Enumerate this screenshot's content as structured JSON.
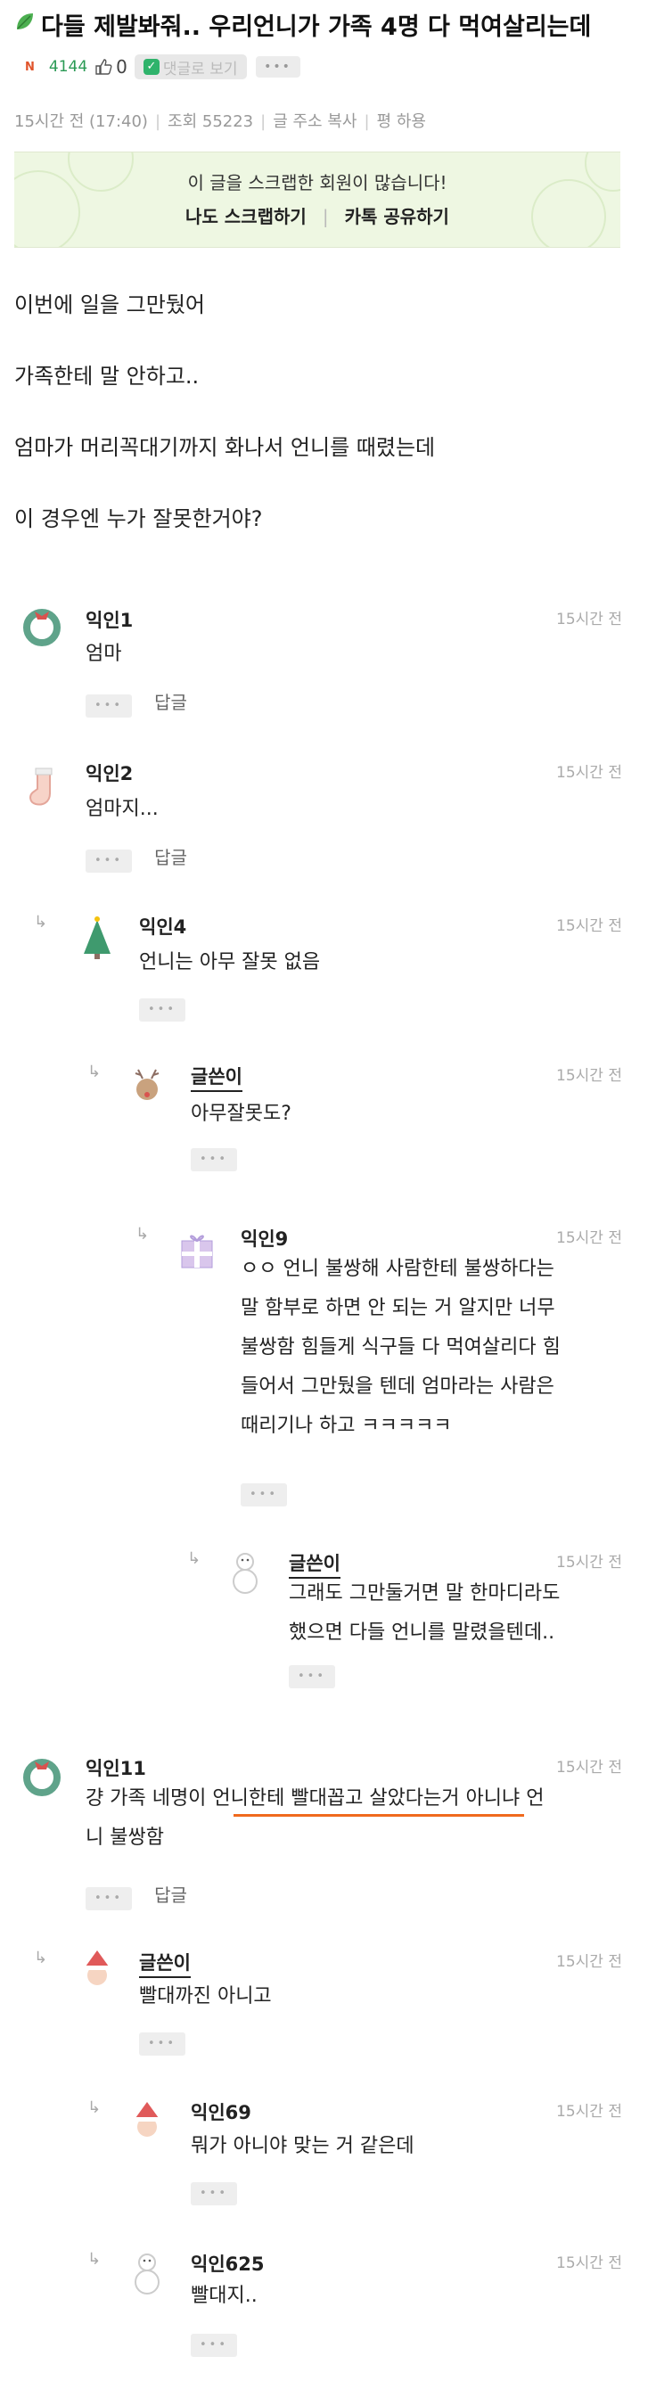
{
  "header": {
    "title": "다들 제발봐줘.. 우리언니가 가족 4명 다 먹여살리는데",
    "badge": "N",
    "count": "4144",
    "likes": "0",
    "pill_label": "댓글로 보기",
    "more": "•••",
    "time": "15시간 전 (17:40)",
    "views": "조회 55223",
    "copy": "글 주소 복사",
    "report": "평 하용"
  },
  "scrap": {
    "message": "이 글을 스크랩한 회원이 많습니다!",
    "action1": "나도 스크랩하기",
    "action2": "카톡 공유하기"
  },
  "body": {
    "p1": "이번에 일을 그만뒀어",
    "p2": "가족한테 말 안하고..",
    "p3": "엄마가 머리꼭대기까지 화나서 언니를 때렸는데",
    "p4": "이 경우엔 누가 잘못한거야?"
  },
  "comments": [
    {
      "name": "익인1",
      "time": "15시간 전",
      "text": "엄마",
      "more": "•••",
      "reply": "답글"
    },
    {
      "name": "익인2",
      "time": "15시간 전",
      "text": "엄마지...",
      "more": "•••",
      "reply": "답글"
    },
    {
      "name": "익인4",
      "time": "15시간 전",
      "text": "언니는 아무 잘못 없음",
      "more": "•••"
    },
    {
      "name": "글쓴이",
      "time": "15시간 전",
      "text": "아무잘못도?",
      "more": "•••"
    },
    {
      "name": "익인9",
      "time": "15시간 전",
      "line1": "ㅇㅇ 언니 불쌍해 사람한테 불쌍하다는",
      "line2": "말 함부로 하면 안 되는 거 알지만 너무",
      "line3": "불쌍함 힘들게 식구들 다 먹여살리다 힘",
      "line4": "들어서 그만뒀을 텐데 엄마라는 사람은",
      "line5": "때리기나 하고 ㅋㅋㅋㅋㅋ",
      "more": "•••"
    },
    {
      "name": "글쓴이",
      "time": "15시간 전",
      "line1": "그래도 그만둘거면 말 한마디라도",
      "line2": "했으면 다들 언니를 말렸을텐데..",
      "more": "•••"
    },
    {
      "name": "익인11",
      "time": "15시간 전",
      "line1": "걍 가족 네명이 언니한테 빨대꼽고 살았다는거 아니냐 언",
      "line2": "니 불쌍함",
      "more": "•••",
      "reply": "답글"
    },
    {
      "name": "글쓴이",
      "time": "15시간 전",
      "text": "빨대까진 아니고",
      "more": "•••"
    },
    {
      "name": "익인69",
      "time": "15시간 전",
      "text": "뭐가 아니야 맞는 거 같은데",
      "more": "•••"
    },
    {
      "name": "익인625",
      "time": "15시간 전",
      "text": "빨대지..",
      "more": "•••"
    }
  ],
  "colors": {
    "accent": "#2a9a55",
    "underline": "#f06a1e",
    "scrap_bg": "#eef7e2"
  }
}
